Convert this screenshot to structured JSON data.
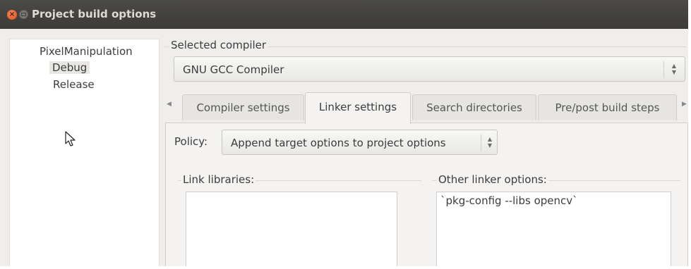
{
  "window": {
    "title": "Project build options",
    "close_glyph": "×"
  },
  "tree": {
    "root": "PixelManipulation",
    "items": [
      "Debug",
      "Release"
    ],
    "selected": "Debug"
  },
  "selected_compiler": {
    "label": "Selected compiler",
    "value": "GNU GCC Compiler"
  },
  "tabs": {
    "items": [
      "Compiler settings",
      "Linker settings",
      "Search directories",
      "Pre/post build steps"
    ],
    "active": "Linker settings",
    "scroll_left_glyph": "◀",
    "scroll_right_glyph": "▶"
  },
  "policy": {
    "label": "Policy:",
    "value": "Append target options to project options"
  },
  "link_libraries": {
    "label": "Link libraries:"
  },
  "other_linker_options": {
    "label": "Other linker options:",
    "value": "`pkg-config --libs opencv`"
  },
  "spinner_glyphs": {
    "up": "▲",
    "down": "▼"
  },
  "colors": {
    "titlebar": "#3c3b37",
    "close_button": "#df4a16",
    "window_bg": "#efeeec"
  },
  "icons": [
    "close-icon",
    "minimize-icon",
    "mouse-pointer-icon",
    "spinner-icon",
    "arrow-left-icon",
    "arrow-right-icon"
  ]
}
